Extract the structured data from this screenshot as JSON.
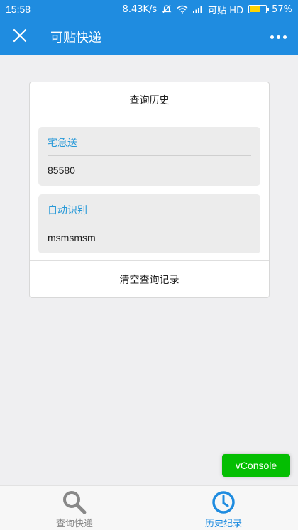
{
  "status_bar": {
    "time": "15:58",
    "network_speed": "8.43K/s",
    "carrier": "可贴 HD",
    "battery": "57%",
    "battery_level": 0.57,
    "icons": [
      "mute-icon",
      "wifi-icon",
      "signal-icon",
      "battery-icon"
    ]
  },
  "nav": {
    "title": "可贴快递",
    "close_icon": "close-icon",
    "more_icon": "more-icon"
  },
  "history": {
    "header": "查询历史",
    "entries": [
      {
        "company": "宅急送",
        "number": "85580"
      },
      {
        "company": "自动识别",
        "number": "msmsmsm"
      }
    ],
    "clear_label": "清空查询记录"
  },
  "vconsole": {
    "label": "vConsole"
  },
  "tabs": [
    {
      "label": "查询快递",
      "icon": "search-icon",
      "active": false
    },
    {
      "label": "历史纪录",
      "icon": "clock-icon",
      "active": true
    }
  ],
  "colors": {
    "primary": "#1f8ce0",
    "accent_text": "#2799d8",
    "vconsole": "#04be02",
    "inactive": "#888888"
  }
}
